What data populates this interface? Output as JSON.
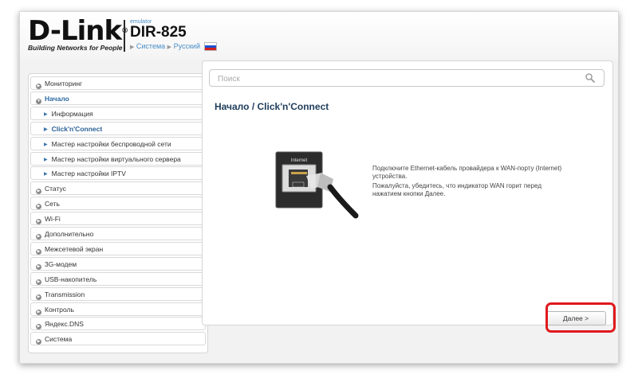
{
  "header": {
    "logo_text": "D-Link",
    "logo_reg": "®",
    "logo_tagline": "Building Networks for People",
    "emulator_label": "emulator",
    "model": "DIR-825",
    "link_system": "Система",
    "link_language": "Русский"
  },
  "search": {
    "placeholder": "Поиск",
    "value": ""
  },
  "breadcrumb": {
    "parent": "Начало",
    "separator": "/",
    "current": "Click'n'Connect"
  },
  "sidebar": {
    "items": [
      {
        "label": "Мониторинг",
        "kind": "top"
      },
      {
        "label": "Начало",
        "kind": "open"
      },
      {
        "label": "Информация",
        "kind": "sub"
      },
      {
        "label": "Click'n'Connect",
        "kind": "sub-active"
      },
      {
        "label": "Мастер настройки беспроводной сети",
        "kind": "sub"
      },
      {
        "label": "Мастер настройки виртуального сервера",
        "kind": "sub"
      },
      {
        "label": "Мастер настройки IPTV",
        "kind": "sub"
      },
      {
        "label": "Статус",
        "kind": "top"
      },
      {
        "label": "Сеть",
        "kind": "top"
      },
      {
        "label": "Wi-Fi",
        "kind": "top"
      },
      {
        "label": "Дополнительно",
        "kind": "top"
      },
      {
        "label": "Межсетевой экран",
        "kind": "top"
      },
      {
        "label": "3G-модем",
        "kind": "top"
      },
      {
        "label": "USB-накопитель",
        "kind": "top"
      },
      {
        "label": "Transmission",
        "kind": "top"
      },
      {
        "label": "Контроль",
        "kind": "top"
      },
      {
        "label": "Яндекс.DNS",
        "kind": "top"
      },
      {
        "label": "Система",
        "kind": "top"
      }
    ]
  },
  "content": {
    "image_port_label": "Internet",
    "message_line1": "Подключите Ethernet-кабель провайдера к WAN-порту (Internet) устройства.",
    "message_line2": "Пожалуйста, убедитесь, что индикатор WAN горит перед нажатием кнопки Далее.",
    "next_button": "Далее >"
  },
  "colors": {
    "accent": "#2d6aa0",
    "highlight": "#e0191e"
  }
}
